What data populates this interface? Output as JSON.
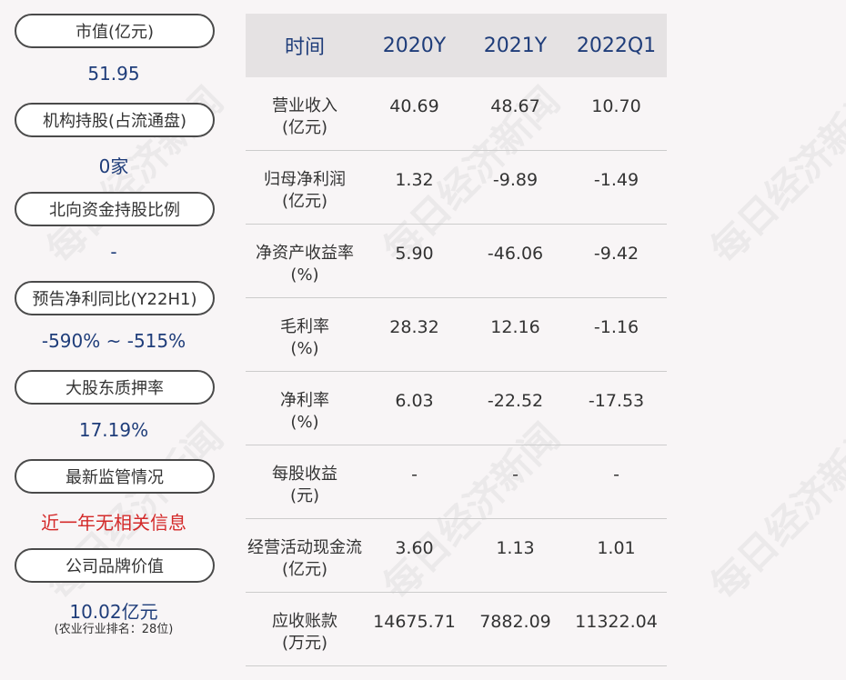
{
  "left": {
    "items": [
      {
        "label": "市值(亿元)",
        "value": "51.95"
      },
      {
        "label": "机构持股(占流通盘)",
        "value": "0家"
      },
      {
        "label": "北向资金持股比例",
        "value": "-"
      },
      {
        "label": "预告净利同比(Y22H1)",
        "value": "-590% ~ -515%"
      },
      {
        "label": "大股东质押率",
        "value": "17.19%"
      },
      {
        "label": "最新监管情况",
        "value": "近一年无相关信息"
      },
      {
        "label": "公司品牌价值",
        "value": "10.02亿元",
        "note": "(农业行业排名：28位)"
      }
    ]
  },
  "table": {
    "headers": [
      "时间",
      "2020Y",
      "2021Y",
      "2022Q1"
    ],
    "rows": [
      {
        "name": "营业收入",
        "unit": "(亿元)",
        "values": [
          "40.69",
          "48.67",
          "10.70"
        ]
      },
      {
        "name": "归母净利润",
        "unit": "(亿元)",
        "values": [
          "1.32",
          "-9.89",
          "-1.49"
        ]
      },
      {
        "name": "净资产收益率",
        "unit": "(%)",
        "values": [
          "5.90",
          "-46.06",
          "-9.42"
        ]
      },
      {
        "name": "毛利率",
        "unit": "(%)",
        "values": [
          "28.32",
          "12.16",
          "-1.16"
        ]
      },
      {
        "name": "净利率",
        "unit": "(%)",
        "values": [
          "6.03",
          "-22.52",
          "-17.53"
        ]
      },
      {
        "name": "每股收益",
        "unit": "(元)",
        "values": [
          "-",
          "-",
          "-"
        ]
      },
      {
        "name": "经营活动现金流",
        "unit": "(亿元)",
        "values": [
          "3.60",
          "1.13",
          "1.01"
        ]
      },
      {
        "name": "应收账款",
        "unit": "(万元)",
        "values": [
          "14675.71",
          "7882.09",
          "11322.04"
        ]
      }
    ]
  },
  "watermark": "每日经济新闻"
}
